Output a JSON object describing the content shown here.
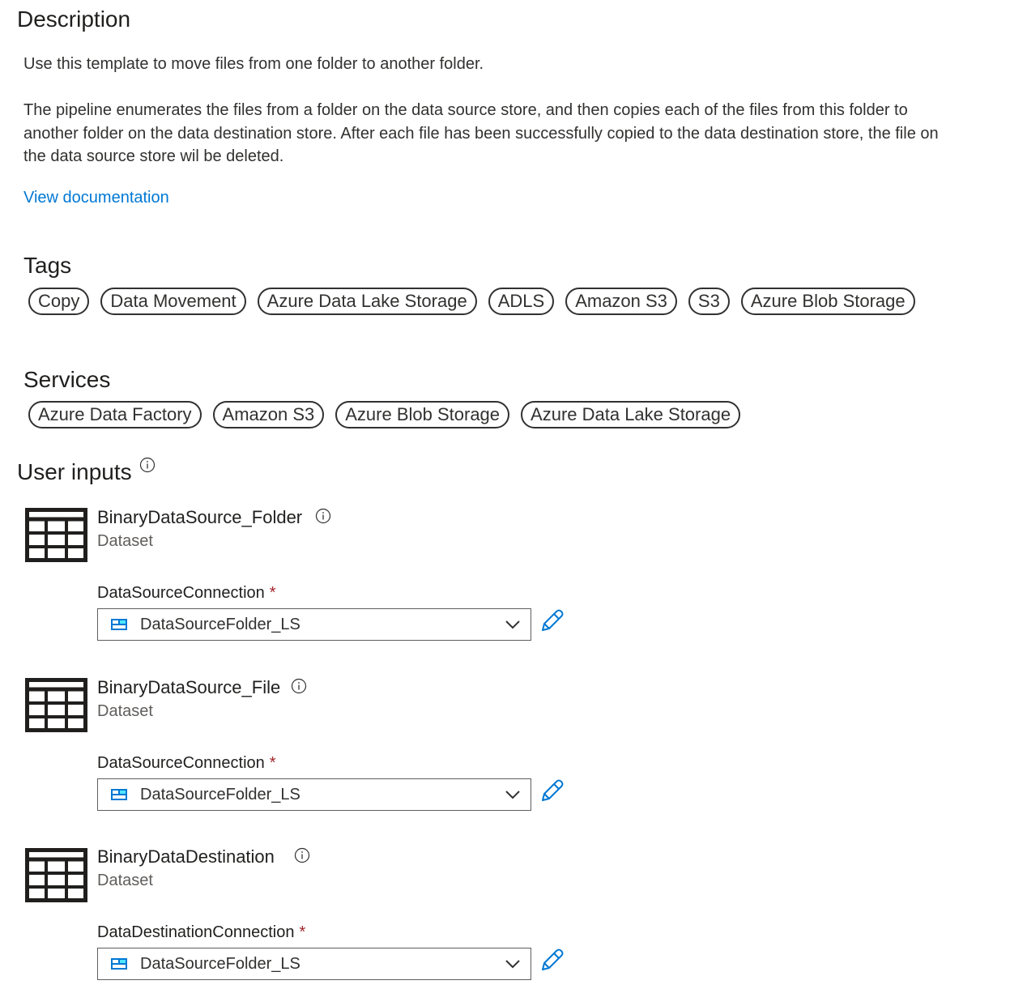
{
  "description": {
    "heading": "Description",
    "summary": "Use this template to move files from one folder to another folder.",
    "details_lines": [
      "The pipeline enumerates the files from a folder on the data source store, and then copies each of the files from this folder to",
      "another folder on the data destination store. After each file has been successfully copied to the data destination store, the file on",
      "the data source store wil be deleted."
    ],
    "link": "View documentation"
  },
  "tags": {
    "heading": "Tags",
    "items": [
      "Copy",
      "Data Movement",
      "Azure Data Lake Storage",
      "ADLS",
      "Amazon S3",
      "S3",
      "Azure Blob Storage"
    ]
  },
  "services": {
    "heading": "Services",
    "items": [
      "Azure Data Factory",
      "Amazon S3",
      "Azure Blob Storage",
      "Azure Data Lake Storage"
    ]
  },
  "user_inputs": {
    "heading": "User inputs",
    "datasets": [
      {
        "name": "BinaryDataSource_Folder",
        "type": "Dataset",
        "field_label": "DataSourceConnection",
        "required_mark": "*",
        "selected": "DataSourceFolder_LS"
      },
      {
        "name": "BinaryDataSource_File",
        "type": "Dataset",
        "field_label": "DataSourceConnection",
        "required_mark": "*",
        "selected": "DataSourceFolder_LS"
      },
      {
        "name": "BinaryDataDestination",
        "type": "Dataset",
        "field_label": "DataDestinationConnection",
        "required_mark": "*",
        "selected": "DataSourceFolder_LS"
      }
    ]
  },
  "colors": {
    "link": "#0078d4",
    "required": "#a4262c",
    "text": "#323130",
    "icon_blue": "#0078d4"
  },
  "icons": {
    "info": "info-circle-icon",
    "dataset": "table-icon",
    "linked_service": "linked-service-icon",
    "dropdown": "chevron-down-icon",
    "edit": "pencil-icon"
  }
}
